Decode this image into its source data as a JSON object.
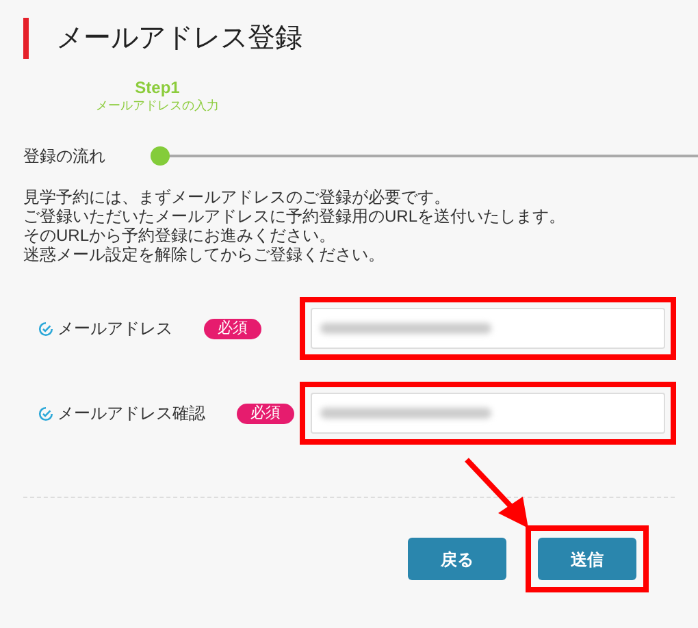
{
  "title": "メールアドレス登録",
  "step": {
    "name": "Step1",
    "caption": "メールアドレスの入力"
  },
  "flow": {
    "label": "登録の流れ",
    "level": 0
  },
  "intro": [
    "見学予約には、まずメールアドレスのご登録が必要です。",
    "ご登録いただいたメールアドレスに予約登録用のURLを送付いたします。",
    "そのURLから予約登録にお進みください。",
    "迷惑メール設定を解除してからご登録ください。"
  ],
  "fields": [
    {
      "label": "メールアドレス",
      "badge": "必須",
      "highlighted": true
    },
    {
      "label": "メールアドレス確認",
      "badge": "必須",
      "highlighted": true
    }
  ],
  "buttons": [
    {
      "label": "戻る",
      "highlighted": false
    },
    {
      "label": "送信",
      "highlighted": true
    }
  ]
}
